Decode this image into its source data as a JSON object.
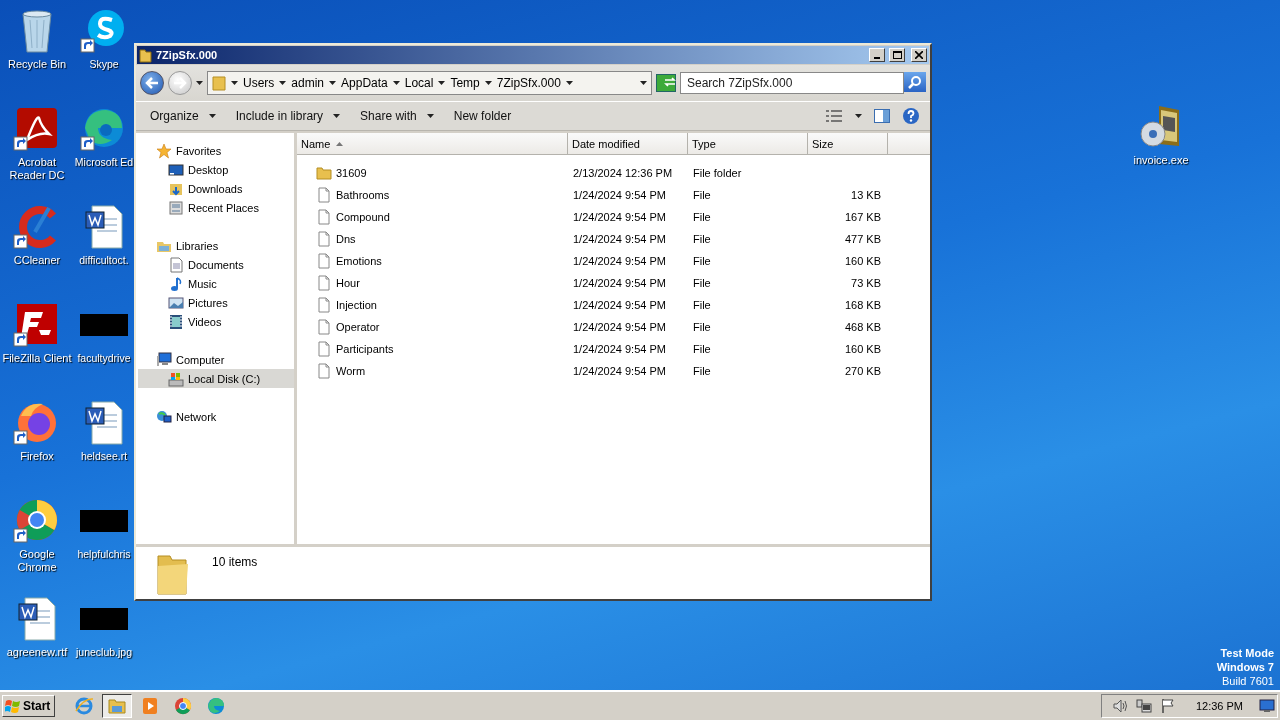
{
  "desktop": {
    "icons": [
      {
        "label": "Recycle Bin",
        "kind": "recycle",
        "shortcut": false
      },
      {
        "label": "Acrobat Reader DC",
        "kind": "acrobat",
        "shortcut": true
      },
      {
        "label": "CCleaner",
        "kind": "ccleaner",
        "shortcut": true
      },
      {
        "label": "FileZilla Client",
        "kind": "filezilla",
        "shortcut": true
      },
      {
        "label": "Firefox",
        "kind": "firefox",
        "shortcut": true
      },
      {
        "label": "Google Chrome",
        "kind": "chrome",
        "shortcut": true
      },
      {
        "label": "agreenew.rtf",
        "kind": "word",
        "shortcut": false
      },
      {
        "label": "Skype",
        "kind": "skype",
        "shortcut": true
      },
      {
        "label": "Microsoft Ed",
        "kind": "edge",
        "shortcut": true
      },
      {
        "label": "difficultoct.",
        "kind": "word",
        "shortcut": false
      },
      {
        "label": "facultydrive",
        "kind": "image",
        "shortcut": false
      },
      {
        "label": "heldsee.rt",
        "kind": "word",
        "shortcut": false
      },
      {
        "label": "helpfulchris",
        "kind": "image",
        "shortcut": false
      },
      {
        "label": "juneclub.jpg",
        "kind": "image",
        "shortcut": false
      }
    ],
    "right_icons": [
      {
        "label": "invoice.exe",
        "kind": "installer",
        "shortcut": false
      }
    ],
    "os_notice": [
      "Test Mode",
      "Windows 7",
      "Build 7601"
    ]
  },
  "window": {
    "title": "7ZipSfx.000",
    "back_enabled": true,
    "forward_enabled": false,
    "breadcrumb": [
      "Users",
      "admin",
      "AppData",
      "Local",
      "Temp",
      "7ZipSfx.000"
    ],
    "search": {
      "placeholder": "Search 7ZipSfx.000"
    },
    "toolbar": [
      {
        "label": "Organize",
        "dropdown": true
      },
      {
        "label": "Include in library",
        "dropdown": true
      },
      {
        "label": "Share with",
        "dropdown": true
      },
      {
        "label": "New folder",
        "dropdown": false
      }
    ],
    "nav_pane": [
      {
        "label": "Favorites",
        "kind": "star",
        "selected": false,
        "children": [
          {
            "label": "Desktop",
            "kind": "desktop",
            "selected": false
          },
          {
            "label": "Downloads",
            "kind": "downloads",
            "selected": false
          },
          {
            "label": "Recent Places",
            "kind": "recent",
            "selected": false
          }
        ]
      },
      {
        "label": "Libraries",
        "kind": "libraries",
        "selected": false,
        "children": [
          {
            "label": "Documents",
            "kind": "documents",
            "selected": false
          },
          {
            "label": "Music",
            "kind": "music",
            "selected": false
          },
          {
            "label": "Pictures",
            "kind": "pictures",
            "selected": false
          },
          {
            "label": "Videos",
            "kind": "videos",
            "selected": false
          }
        ]
      },
      {
        "label": "Computer",
        "kind": "computer",
        "selected": false,
        "children": [
          {
            "label": "Local Disk (C:)",
            "kind": "disk",
            "selected": true
          }
        ]
      },
      {
        "label": "Network",
        "kind": "network",
        "selected": false
      }
    ],
    "columns": [
      {
        "label": "Name",
        "sorted": true
      },
      {
        "label": "Date modified",
        "sorted": false
      },
      {
        "label": "Type",
        "sorted": false
      },
      {
        "label": "Size",
        "sorted": false
      }
    ],
    "rows": [
      {
        "name": "31609",
        "date": "2/13/2024 12:36 PM",
        "type": "File folder",
        "kind": "folder"
      },
      {
        "name": "Bathrooms",
        "date": "1/24/2024 9:54 PM",
        "type": "File",
        "size": "13 KB",
        "kind": "file"
      },
      {
        "name": "Compound",
        "date": "1/24/2024 9:54 PM",
        "type": "File",
        "size": "167 KB",
        "kind": "file"
      },
      {
        "name": "Dns",
        "date": "1/24/2024 9:54 PM",
        "type": "File",
        "size": "477 KB",
        "kind": "file"
      },
      {
        "name": "Emotions",
        "date": "1/24/2024 9:54 PM",
        "type": "File",
        "size": "160 KB",
        "kind": "file"
      },
      {
        "name": "Hour",
        "date": "1/24/2024 9:54 PM",
        "type": "File",
        "size": "73 KB",
        "kind": "file"
      },
      {
        "name": "Injection",
        "date": "1/24/2024 9:54 PM",
        "type": "File",
        "size": "168 KB",
        "kind": "file"
      },
      {
        "name": "Operator",
        "date": "1/24/2024 9:54 PM",
        "type": "File",
        "size": "468 KB",
        "kind": "file"
      },
      {
        "name": "Participants",
        "date": "1/24/2024 9:54 PM",
        "type": "File",
        "size": "160 KB",
        "kind": "file"
      },
      {
        "name": "Worm",
        "date": "1/24/2024 9:54 PM",
        "type": "File",
        "size": "270 KB",
        "kind": "file"
      }
    ],
    "status": {
      "count": "10 items"
    }
  },
  "taskbar": {
    "start": "Start",
    "apps": [
      {
        "kind": "ie",
        "selected": false
      },
      {
        "kind": "explorer",
        "selected": true
      },
      {
        "kind": "media",
        "selected": false
      },
      {
        "kind": "chrome",
        "selected": false
      },
      {
        "kind": "edge",
        "selected": false
      }
    ],
    "clock": "12:36 PM"
  }
}
